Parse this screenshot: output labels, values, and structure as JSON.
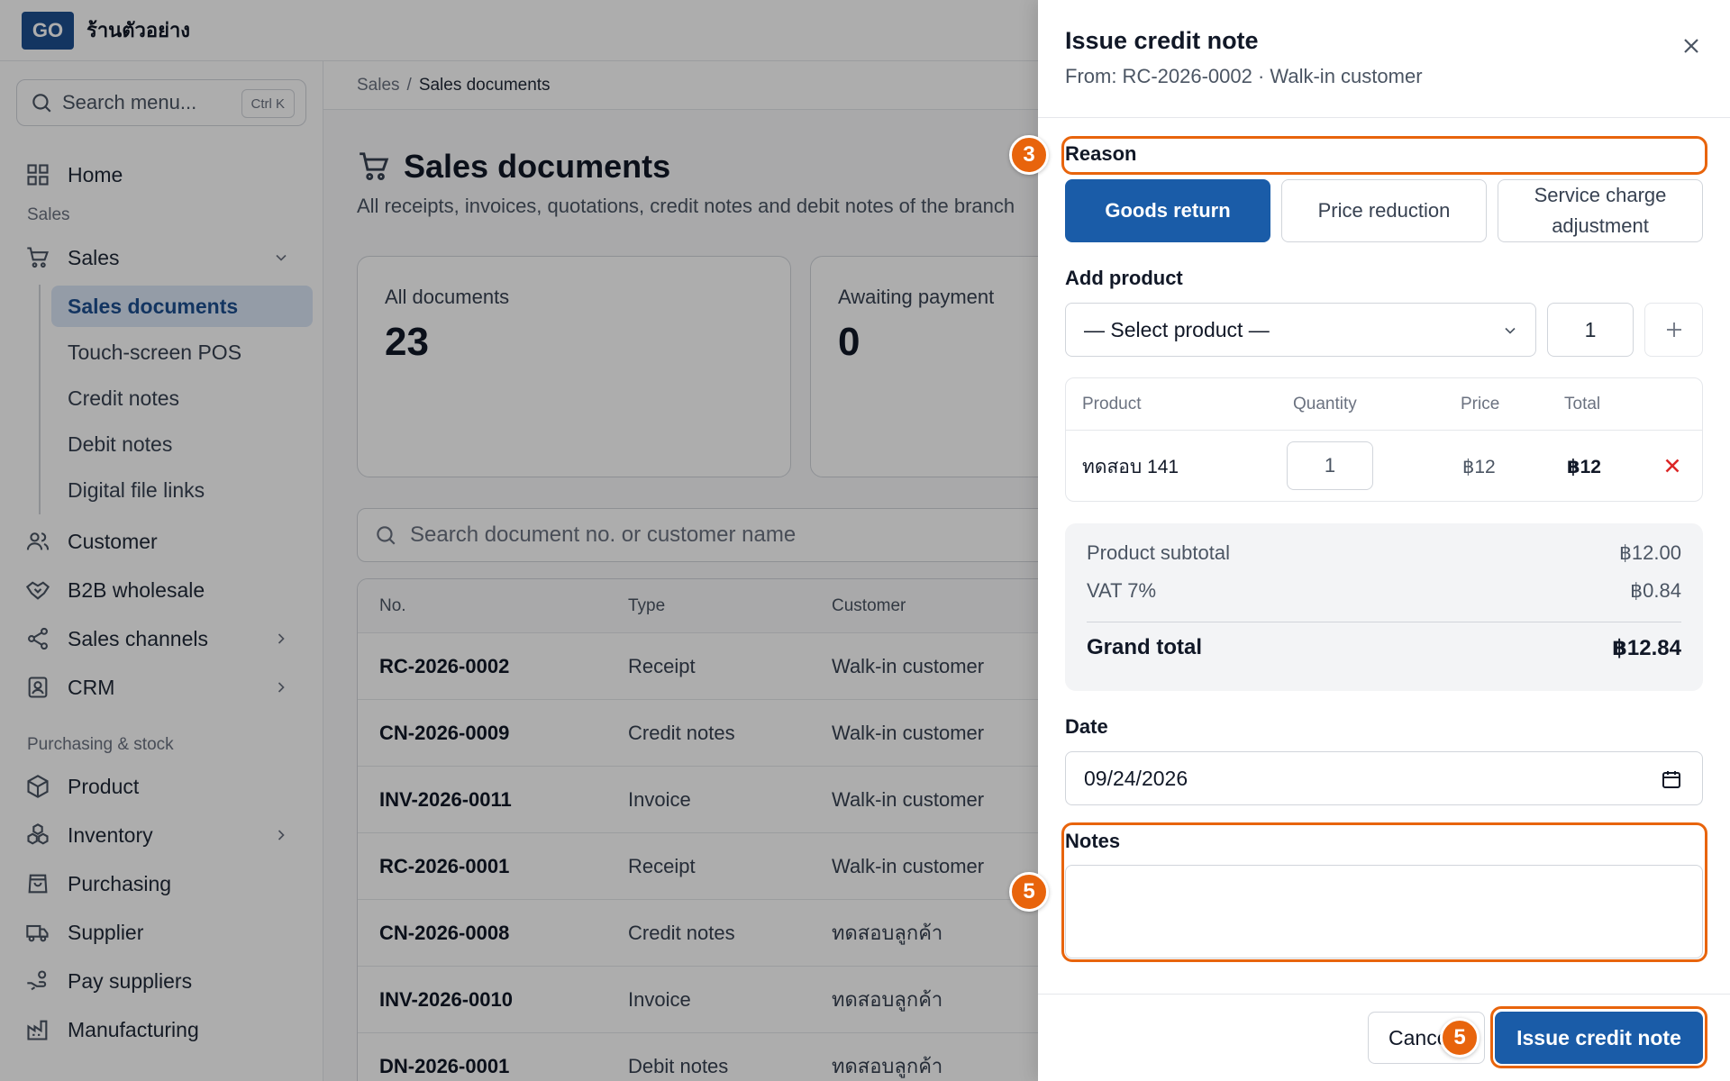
{
  "app": {
    "logo": "GO",
    "shop_name": "ร้านตัวอย่าง"
  },
  "sidebar": {
    "search_placeholder": "Search menu...",
    "search_shortcut": "Ctrl K",
    "home": "Home",
    "section_sales": "Sales",
    "sales": "Sales",
    "sales_sub": [
      "Sales documents",
      "Touch-screen POS",
      "Credit notes",
      "Debit notes",
      "Digital file links"
    ],
    "customer": "Customer",
    "b2b": "B2B wholesale",
    "channels": "Sales channels",
    "crm": "CRM",
    "section_purchasing": "Purchasing & stock",
    "product": "Product",
    "inventory": "Inventory",
    "purchasing": "Purchasing",
    "supplier": "Supplier",
    "pay_suppliers": "Pay suppliers",
    "manufacturing": "Manufacturing"
  },
  "main": {
    "breadcrumb": [
      "Sales",
      "/",
      "Sales documents"
    ],
    "title": "Sales documents",
    "subtitle": "All receipts, invoices, quotations, credit notes and debit notes of the branch",
    "stats": [
      {
        "label": "All documents",
        "value": "23"
      },
      {
        "label": "Awaiting payment",
        "value": "0"
      }
    ],
    "search_placeholder": "Search document no. or customer name",
    "table_headers": [
      "No.",
      "Type",
      "Customer"
    ],
    "rows": [
      {
        "no": "RC-2026-0002",
        "type": "Receipt",
        "customer": "Walk-in customer"
      },
      {
        "no": "CN-2026-0009",
        "type": "Credit notes",
        "customer": "Walk-in customer"
      },
      {
        "no": "INV-2026-0011",
        "type": "Invoice",
        "customer": "Walk-in customer"
      },
      {
        "no": "RC-2026-0001",
        "type": "Receipt",
        "customer": "Walk-in customer"
      },
      {
        "no": "CN-2026-0008",
        "type": "Credit notes",
        "customer": "ทดสอบลูกค้า"
      },
      {
        "no": "INV-2026-0010",
        "type": "Invoice",
        "customer": "ทดสอบลูกค้า"
      },
      {
        "no": "DN-2026-0001",
        "type": "Debit notes",
        "customer": "ทดสอบลูกค้า"
      }
    ]
  },
  "drawer": {
    "title": "Issue credit note",
    "subtitle": "From: RC-2026-0002 · Walk-in customer",
    "reason_label": "Reason",
    "reasons": [
      "Goods return",
      "Price reduction",
      "Service charge adjustment"
    ],
    "selected_reason": "Goods return",
    "add_product_label": "Add product",
    "select_placeholder": "— Select product —",
    "add_qty": "1",
    "product_table": {
      "headers": [
        "Product",
        "Quantity",
        "Price",
        "Total"
      ],
      "rows": [
        {
          "product": "ทดสอบ 141",
          "qty": "1",
          "price": "฿12",
          "total": "฿12"
        }
      ]
    },
    "totals": {
      "subtotal_label": "Product subtotal",
      "subtotal": "฿12.00",
      "vat_label": "VAT 7%",
      "vat": "฿0.84",
      "grand_label": "Grand total",
      "grand": "฿12.84"
    },
    "date_label": "Date",
    "date_value": "09/24/2026",
    "notes_label": "Notes",
    "notes_value": "",
    "cancel_label": "Cancel",
    "issue_label": "Issue credit note"
  },
  "annotations": {
    "badge_reason": "3",
    "badge_notes": "5",
    "badge_submit": "5",
    "color": "#e8640c"
  },
  "colors": {
    "primary": "#1a5ca8",
    "brand": "#1d4e8f",
    "danger": "#dc2626"
  }
}
